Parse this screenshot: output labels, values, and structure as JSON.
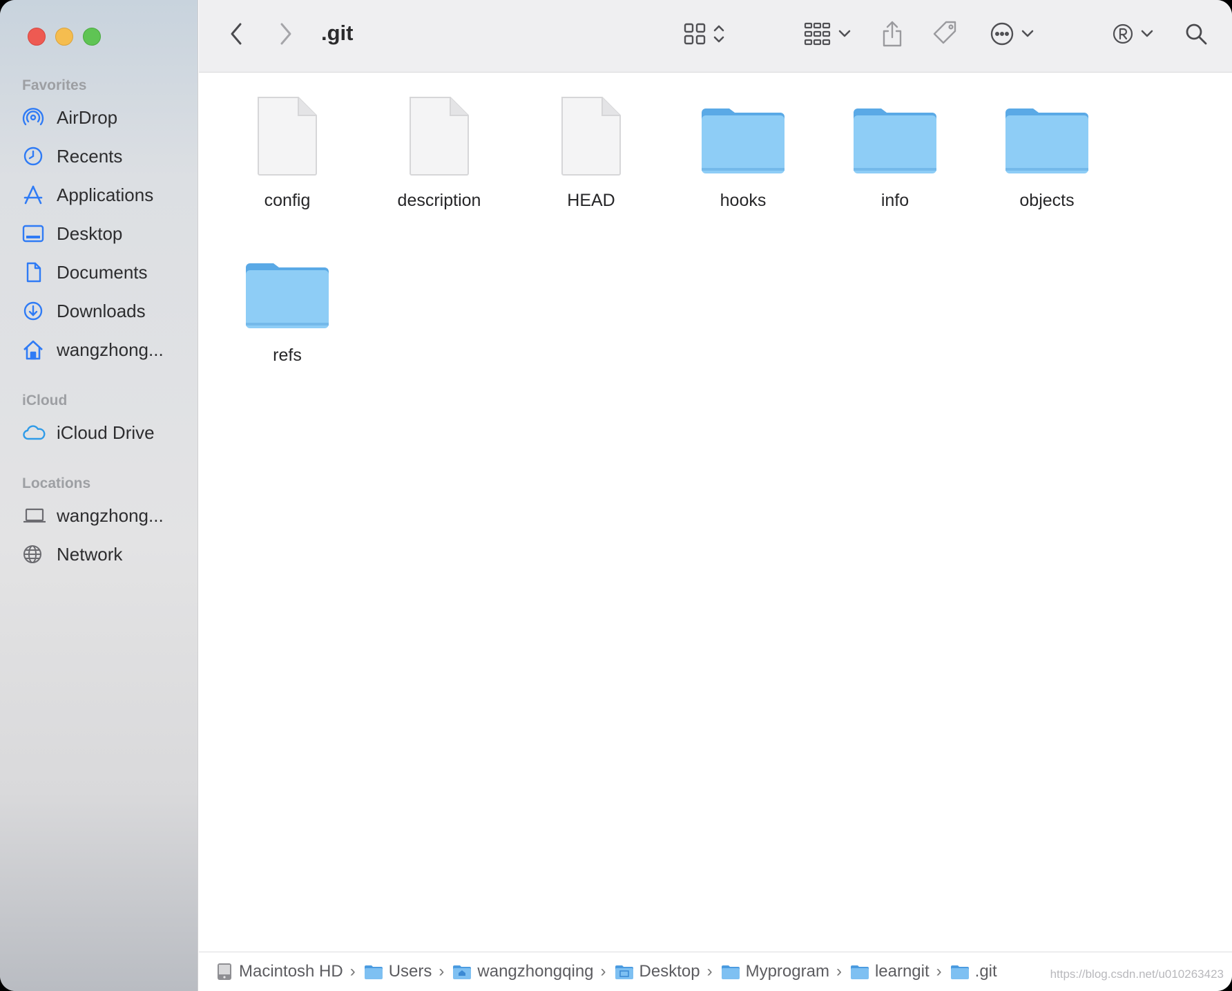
{
  "window": {
    "title": ".git"
  },
  "sidebar": {
    "sections": [
      {
        "header": "Favorites",
        "items": [
          {
            "label": "AirDrop",
            "icon": "airdrop-icon"
          },
          {
            "label": "Recents",
            "icon": "clock-icon"
          },
          {
            "label": "Applications",
            "icon": "applications-icon"
          },
          {
            "label": "Desktop",
            "icon": "desktop-icon"
          },
          {
            "label": "Documents",
            "icon": "document-icon"
          },
          {
            "label": "Downloads",
            "icon": "download-icon"
          },
          {
            "label": "wangzhong...",
            "icon": "home-icon"
          }
        ]
      },
      {
        "header": "iCloud",
        "items": [
          {
            "label": "iCloud Drive",
            "icon": "cloud-icon"
          }
        ]
      },
      {
        "header": "Locations",
        "items": [
          {
            "label": "wangzhong...",
            "icon": "laptop-icon"
          },
          {
            "label": "Network",
            "icon": "globe-icon"
          }
        ]
      }
    ]
  },
  "files": [
    {
      "name": "config",
      "kind": "document"
    },
    {
      "name": "description",
      "kind": "document"
    },
    {
      "name": "HEAD",
      "kind": "document"
    },
    {
      "name": "hooks",
      "kind": "folder"
    },
    {
      "name": "info",
      "kind": "folder"
    },
    {
      "name": "objects",
      "kind": "folder"
    },
    {
      "name": "refs",
      "kind": "folder"
    }
  ],
  "path_bar": [
    {
      "label": "Macintosh HD",
      "icon": "hard-drive-icon"
    },
    {
      "label": "Users",
      "icon": "folder-icon"
    },
    {
      "label": "wangzhongqing",
      "icon": "home-folder-icon"
    },
    {
      "label": "Desktop",
      "icon": "desktop-folder-icon"
    },
    {
      "label": "Myprogram",
      "icon": "folder-icon"
    },
    {
      "label": "learngit",
      "icon": "folder-icon"
    },
    {
      "label": ".git",
      "icon": "folder-icon"
    }
  ],
  "watermark": "https://blog.csdn.net/u010263423",
  "colors": {
    "accent": "#2f7bf5",
    "folder": "#8ecdf6",
    "folder_tab": "#5aa9e6"
  }
}
